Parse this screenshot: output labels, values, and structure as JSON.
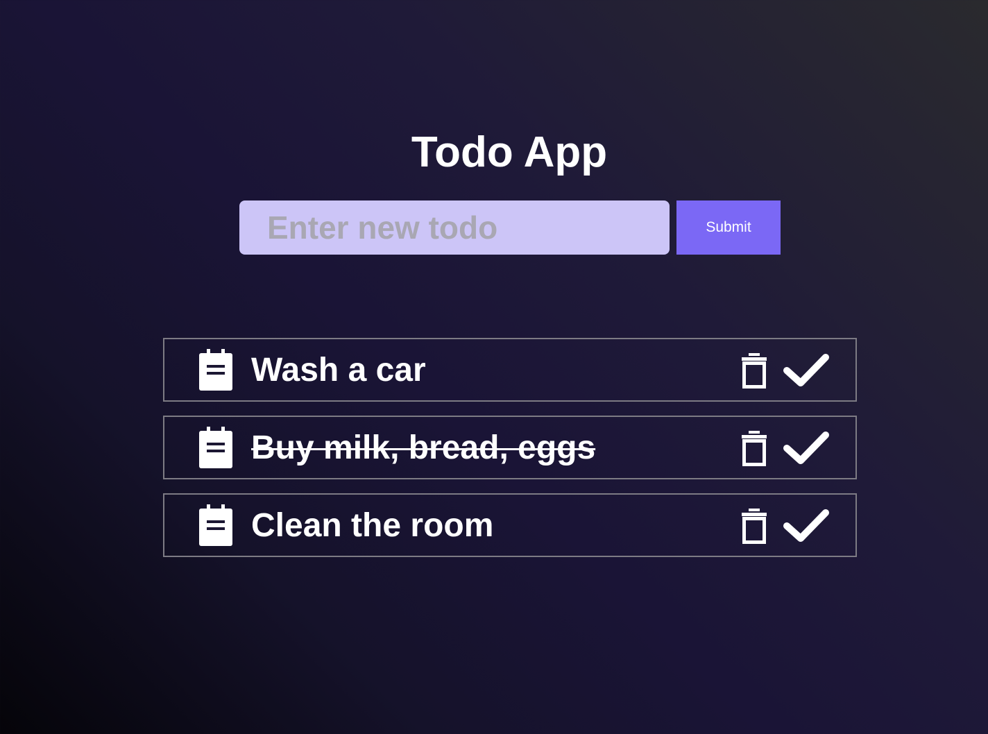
{
  "app": {
    "title": "Todo App"
  },
  "form": {
    "placeholder": "Enter new todo",
    "value": "",
    "submit_label": "Submit"
  },
  "todos": [
    {
      "text": "Wash a car",
      "completed": false
    },
    {
      "text": "Buy milk, bread, eggs",
      "completed": true
    },
    {
      "text": "Clean the room",
      "completed": false
    }
  ],
  "icons": {
    "item_icon": "clipboard-note-icon",
    "delete_icon": "trash-icon",
    "complete_icon": "checkmark-icon"
  },
  "colors": {
    "input_background": "#ccc5f7",
    "submit_background": "#7b68f5",
    "item_border": "#7d7b84",
    "text": "#ffffff"
  }
}
